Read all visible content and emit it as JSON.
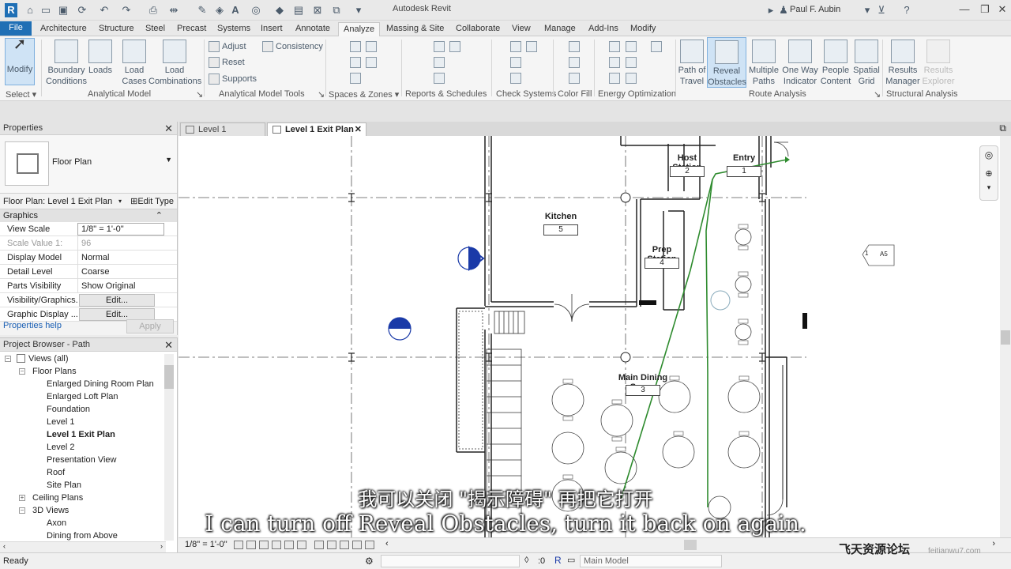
{
  "app": {
    "title": "Autodesk Revit",
    "user": "Paul F. Aubin",
    "logo": "R"
  },
  "tabs": [
    "Architecture",
    "Structure",
    "Steel",
    "Precast",
    "Systems",
    "Insert",
    "Annotate",
    "Analyze",
    "Massing & Site",
    "Collaborate",
    "View",
    "Manage",
    "Add-Ins",
    "Modify"
  ],
  "file_tab": "File",
  "active_tab": "Analyze",
  "ribbon": {
    "modify": "Modify",
    "select": "Select",
    "boundary_conditions": [
      "Boundary",
      "Conditions"
    ],
    "loads": "Loads",
    "load_cases": [
      "Load",
      "Cases"
    ],
    "load_combinations": [
      "Load",
      "Combinations"
    ],
    "adjust": "Adjust",
    "reset": "Reset",
    "supports": "Supports",
    "consistency": "Consistency",
    "path_of_travel": [
      "Path of",
      "Travel"
    ],
    "reveal_obstacles": [
      "Reveal",
      "Obstacles"
    ],
    "multiple_paths": [
      "Multiple",
      "Paths"
    ],
    "one_way_indicator": [
      "One Way",
      "Indicator"
    ],
    "people_content": [
      "People",
      "Content"
    ],
    "spatial_grid": [
      "Spatial",
      "Grid"
    ],
    "results_manager": [
      "Results",
      "Manager"
    ],
    "results_explorer": [
      "Results",
      "Explorer"
    ],
    "panels": {
      "select": "Select",
      "analytical_model": "Analytical Model",
      "analytical_model_tools": "Analytical Model Tools",
      "spaces_zones": "Spaces & Zones",
      "reports_schedules": "Reports & Schedules",
      "check_systems": "Check Systems",
      "color_fill": "Color Fill",
      "energy_optimization": "Energy Optimization",
      "route_analysis": "Route Analysis",
      "structural_analysis": "Structural Analysis"
    }
  },
  "properties": {
    "title": "Properties",
    "type_name": "Floor Plan",
    "instance": "Floor Plan: Level 1 Exit Plan",
    "edit_type": "Edit Type",
    "section": "Graphics",
    "rows": [
      {
        "name": "View Scale",
        "value": "1/8\" = 1'-0\""
      },
      {
        "name": "Scale Value    1:",
        "value": "96"
      },
      {
        "name": "Display Model",
        "value": "Normal"
      },
      {
        "name": "Detail Level",
        "value": "Coarse"
      },
      {
        "name": "Parts Visibility",
        "value": "Show Original"
      },
      {
        "name": "Visibility/Graphics...",
        "value": "Edit..."
      },
      {
        "name": "Graphic Display ...",
        "value": "Edit..."
      }
    ],
    "help": "Properties help",
    "apply": "Apply"
  },
  "browser": {
    "title": "Project Browser - Path",
    "items": [
      {
        "label": "Views (all)",
        "level": 0
      },
      {
        "label": "Floor Plans",
        "level": 1
      },
      {
        "label": "Enlarged Dining Room Plan",
        "level": 2
      },
      {
        "label": "Enlarged Loft Plan",
        "level": 2
      },
      {
        "label": "Foundation",
        "level": 2
      },
      {
        "label": "Level 1",
        "level": 2
      },
      {
        "label": "Level 1 Exit Plan",
        "level": 2
      },
      {
        "label": "Level 2",
        "level": 2
      },
      {
        "label": "Presentation View",
        "level": 2
      },
      {
        "label": "Roof",
        "level": 2
      },
      {
        "label": "Site Plan",
        "level": 2
      },
      {
        "label": "Ceiling Plans",
        "level": 1
      },
      {
        "label": "3D Views",
        "level": 1
      },
      {
        "label": "Axon",
        "level": 2
      },
      {
        "label": "Dining from Above",
        "level": 2
      }
    ]
  },
  "view_tabs": [
    {
      "label": "Level 1"
    },
    {
      "label": "Level 1 Exit Plan"
    }
  ],
  "rooms": [
    {
      "name": "Host Station",
      "number": "2"
    },
    {
      "name": "Entry",
      "number": "1"
    },
    {
      "name": "Kitchen",
      "number": "5"
    },
    {
      "name": "Prep Station",
      "number": "4"
    },
    {
      "name": "Main Dining Space",
      "number": "3"
    }
  ],
  "elevation_tag": {
    "number": "1",
    "sheet": "A5"
  },
  "path_color": "#2e8b2e",
  "view_bar": {
    "scale": "1/8\" = 1'-0\""
  },
  "status": {
    "text": "Ready",
    "zero": ":0",
    "workset": "Main Model"
  },
  "subtitles": {
    "cn": "我可以关闭 \"揭示障碍\" 再把它打开",
    "en": "I can turn off Reveal Obstacles, turn it back on again."
  },
  "watermark": "飞天资源论坛",
  "watermark2": "feitianwu7.com"
}
